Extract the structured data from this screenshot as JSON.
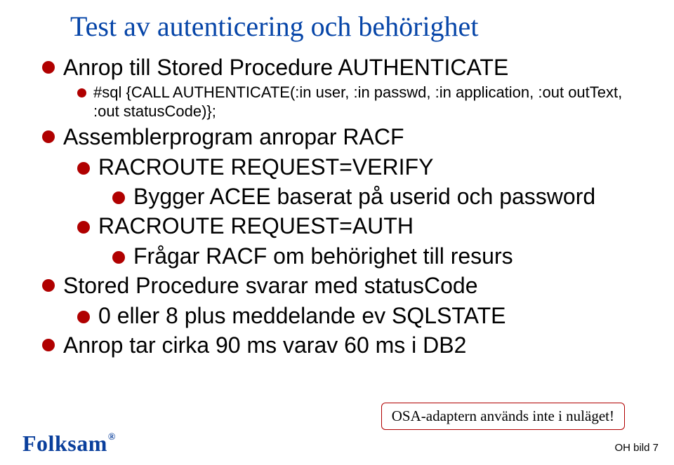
{
  "title": "Test av autenticering och behörighet",
  "bullets": {
    "b1": "Anrop till Stored Procedure AUTHENTICATE",
    "b1_code": "#sql {CALL AUTHENTICATE(:in user, :in passwd, :in application, :out outText, :out statusCode)};",
    "b2": "Assemblerprogram anropar RACF",
    "b2_1": "RACROUTE REQUEST=VERIFY",
    "b2_1_1": "Bygger ACEE baserat på userid och password",
    "b2_2": "RACROUTE REQUEST=AUTH",
    "b2_2_1": "Frågar RACF om behörighet till resurs",
    "b3": "Stored Procedure svarar med statusCode",
    "b3_1": "0 eller 8 plus meddelande ev SQLSTATE",
    "b4": "Anrop tar cirka 90 ms varav 60 ms i DB2"
  },
  "callout": "OSA-adaptern används inte i nuläget!",
  "logo": "Folksam",
  "footer_right": "OH bild 7"
}
